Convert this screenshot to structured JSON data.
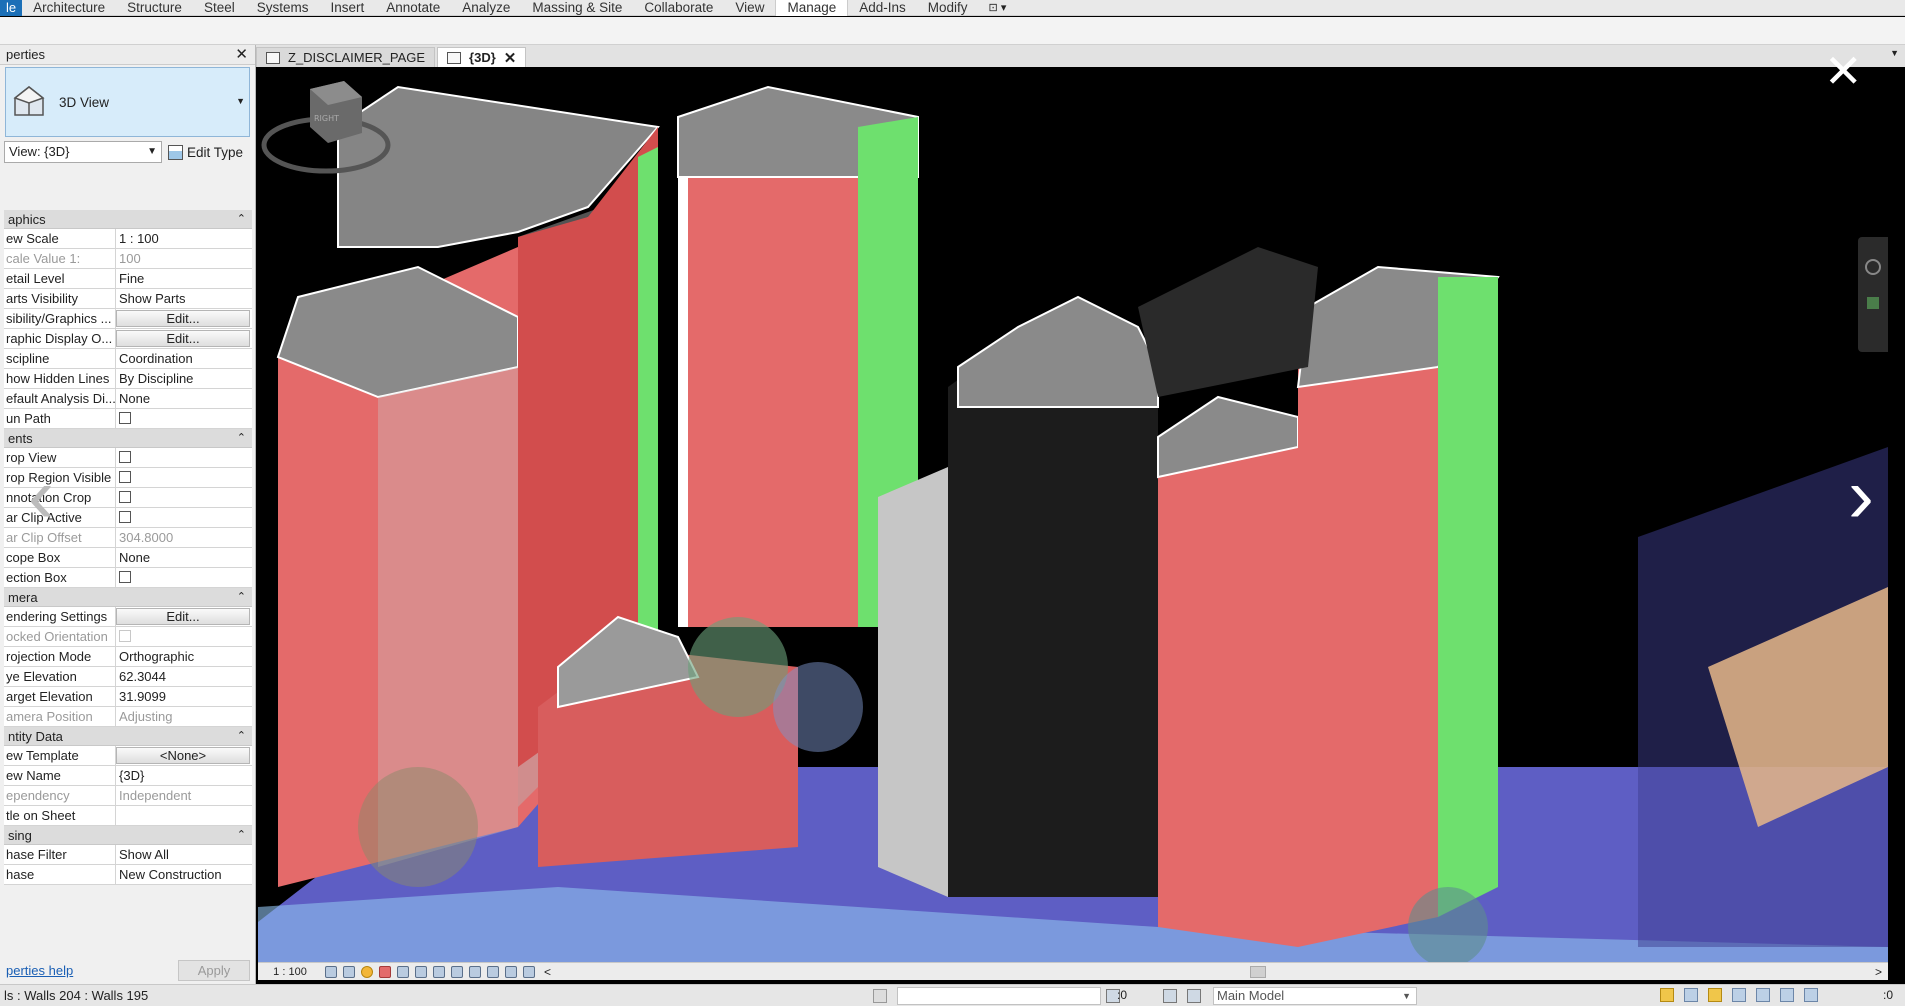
{
  "ribbon": {
    "file_tab": "le",
    "items": [
      "Architecture",
      "Structure",
      "Steel",
      "Systems",
      "Insert",
      "Annotate",
      "Analyze",
      "Massing & Site",
      "Collaborate",
      "View",
      "Manage",
      "Add-Ins",
      "Modify"
    ],
    "active_item": "Manage",
    "extra": "⊡ ▾"
  },
  "properties": {
    "title": "perties",
    "close": "✕",
    "type_name": "3D View",
    "view_selector": "View: {3D}",
    "edit_type": "Edit Type",
    "groups": [
      {
        "name": "aphics",
        "rows": [
          {
            "k": "ew Scale",
            "v": "1 : 100"
          },
          {
            "k": "cale Value    1:",
            "v": "100",
            "dim": true
          },
          {
            "k": "etail Level",
            "v": "Fine"
          },
          {
            "k": "arts Visibility",
            "v": "Show Parts"
          },
          {
            "k": "sibility/Graphics ...",
            "v": "Edit...",
            "btn": true
          },
          {
            "k": "raphic Display O...",
            "v": "Edit...",
            "btn": true
          },
          {
            "k": "scipline",
            "v": "Coordination"
          },
          {
            "k": "how Hidden Lines",
            "v": "By Discipline"
          },
          {
            "k": "efault Analysis Di...",
            "v": "None"
          },
          {
            "k": "un Path",
            "cb": true
          }
        ]
      },
      {
        "name": "ents",
        "rows": [
          {
            "k": "rop View",
            "cb": true
          },
          {
            "k": "rop Region Visible",
            "cb": true
          },
          {
            "k": "nnotation Crop",
            "cb": true
          },
          {
            "k": "ar Clip Active",
            "cb": true
          },
          {
            "k": "ar Clip Offset",
            "v": "304.8000",
            "dim": true
          },
          {
            "k": "cope Box",
            "v": "None"
          },
          {
            "k": "ection Box",
            "cb": true
          }
        ]
      },
      {
        "name": "mera",
        "rows": [
          {
            "k": "endering Settings",
            "v": "Edit...",
            "btn": true
          },
          {
            "k": "ocked Orientation",
            "cb": true,
            "dim": true
          },
          {
            "k": "rojection Mode",
            "v": "Orthographic"
          },
          {
            "k": "ye Elevation",
            "v": "62.3044"
          },
          {
            "k": "arget Elevation",
            "v": "31.9099"
          },
          {
            "k": "amera Position",
            "v": "Adjusting",
            "dim": true
          }
        ]
      },
      {
        "name": "ntity Data",
        "rows": [
          {
            "k": "ew Template",
            "v": "<None>",
            "btn": true
          },
          {
            "k": "ew Name",
            "v": "{3D}"
          },
          {
            "k": "ependency",
            "v": "Independent",
            "dim": true
          },
          {
            "k": "tle on Sheet",
            "v": ""
          }
        ]
      },
      {
        "name": "sing",
        "rows": [
          {
            "k": "hase Filter",
            "v": "Show All"
          },
          {
            "k": "hase",
            "v": "New Construction"
          }
        ]
      }
    ],
    "help_link": "perties help",
    "apply": "Apply"
  },
  "tabs": [
    {
      "label": "Z_DISCLAIMER_PAGE",
      "active": false
    },
    {
      "label": "{3D}",
      "active": true
    }
  ],
  "viewbar": {
    "scale": "1 : 100",
    "left_arrow": "<",
    "right_arrow": ">"
  },
  "statusbar": {
    "status_text": "ls : Walls 204 : Walls 195",
    "zero_a": ":0",
    "model": "Main Model",
    "zero_b": ":0"
  },
  "overlay": {
    "close": "✕",
    "prev": "‹",
    "next": "›"
  },
  "colors": {
    "file_tab": "#1b6fb7",
    "type_selector": "#d7ecfa",
    "canvas_bg": "#000000",
    "facade_red": "#ef6f6f",
    "facade_green": "#6fe06f",
    "roof_grey": "#8e8e8e",
    "ground_blue": "#7b7bf0"
  }
}
